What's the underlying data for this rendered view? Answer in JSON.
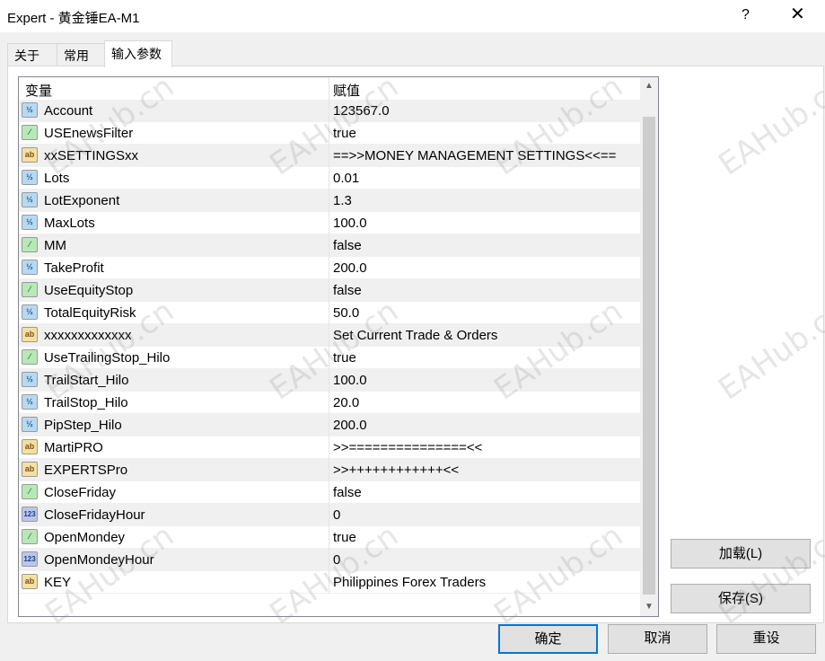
{
  "window": {
    "title": "Expert - 黄金锤EA-M1",
    "help_label": "?",
    "close_label": "✕"
  },
  "tabs": [
    {
      "label": "关于",
      "active": false
    },
    {
      "label": "常用",
      "active": false
    },
    {
      "label": "输入参数",
      "active": true
    }
  ],
  "grid": {
    "columns": [
      "变量",
      "赋值"
    ],
    "rows": [
      {
        "type": "double",
        "icon": "double-icon",
        "icon_text": "½",
        "name": "Account",
        "value": "123567.0"
      },
      {
        "type": "bool",
        "icon": "bool-icon",
        "icon_text": "⁄",
        "name": "USEnewsFilter",
        "value": "true"
      },
      {
        "type": "string",
        "icon": "string-icon",
        "icon_text": "ab",
        "name": "xxSETTINGSxx",
        "value": "==>>MONEY MANAGEMENT SETTINGS<<=="
      },
      {
        "type": "double",
        "icon": "double-icon",
        "icon_text": "½",
        "name": "Lots",
        "value": "0.01"
      },
      {
        "type": "double",
        "icon": "double-icon",
        "icon_text": "½",
        "name": "LotExponent",
        "value": "1.3"
      },
      {
        "type": "double",
        "icon": "double-icon",
        "icon_text": "½",
        "name": "MaxLots",
        "value": "100.0"
      },
      {
        "type": "bool",
        "icon": "bool-icon",
        "icon_text": "⁄",
        "name": "MM",
        "value": "false"
      },
      {
        "type": "double",
        "icon": "double-icon",
        "icon_text": "½",
        "name": "TakeProfit",
        "value": "200.0"
      },
      {
        "type": "bool",
        "icon": "bool-icon",
        "icon_text": "⁄",
        "name": "UseEquityStop",
        "value": "false"
      },
      {
        "type": "double",
        "icon": "double-icon",
        "icon_text": "½",
        "name": "TotalEquityRisk",
        "value": "50.0"
      },
      {
        "type": "string",
        "icon": "string-icon",
        "icon_text": "ab",
        "name": "xxxxxxxxxxxxx",
        "value": "Set Current Trade & Orders"
      },
      {
        "type": "bool",
        "icon": "bool-icon",
        "icon_text": "⁄",
        "name": "UseTrailingStop_Hilo",
        "value": "true"
      },
      {
        "type": "double",
        "icon": "double-icon",
        "icon_text": "½",
        "name": "TrailStart_Hilo",
        "value": "100.0"
      },
      {
        "type": "double",
        "icon": "double-icon",
        "icon_text": "½",
        "name": "TrailStop_Hilo",
        "value": "20.0"
      },
      {
        "type": "double",
        "icon": "double-icon",
        "icon_text": "½",
        "name": "PipStep_Hilo",
        "value": "200.0"
      },
      {
        "type": "string",
        "icon": "string-icon",
        "icon_text": "ab",
        "name": "MartiPRO",
        "value": ">>===============<<"
      },
      {
        "type": "string",
        "icon": "string-icon",
        "icon_text": "ab",
        "name": "EXPERTSPro",
        "value": ">>++++++++++++<<"
      },
      {
        "type": "bool",
        "icon": "bool-icon",
        "icon_text": "⁄",
        "name": "CloseFriday",
        "value": "false"
      },
      {
        "type": "int",
        "icon": "int-icon",
        "icon_text": "123",
        "name": "CloseFridayHour",
        "value": "0"
      },
      {
        "type": "bool",
        "icon": "bool-icon",
        "icon_text": "⁄",
        "name": "OpenMondey",
        "value": "true"
      },
      {
        "type": "int",
        "icon": "int-icon",
        "icon_text": "123",
        "name": "OpenMondeyHour",
        "value": "0"
      },
      {
        "type": "string",
        "icon": "string-icon",
        "icon_text": "ab",
        "name": "KEY",
        "value": "Philippines Forex Traders"
      }
    ]
  },
  "scrollbar": {
    "up_glyph": "▲",
    "down_glyph": "▼"
  },
  "buttons": {
    "load": "加载(L)",
    "save": "保存(S)",
    "ok": "确定",
    "cancel": "取消",
    "reset": "重设"
  },
  "watermark": "EAHub.cn",
  "colors": {
    "accent": "#0078d7",
    "alt_row": "#f0f0f0",
    "double_icon": "#b8d9f2",
    "bool_icon": "#b8e8b8",
    "string_icon": "#f6dfa2",
    "int_icon": "#b9c6ee"
  }
}
